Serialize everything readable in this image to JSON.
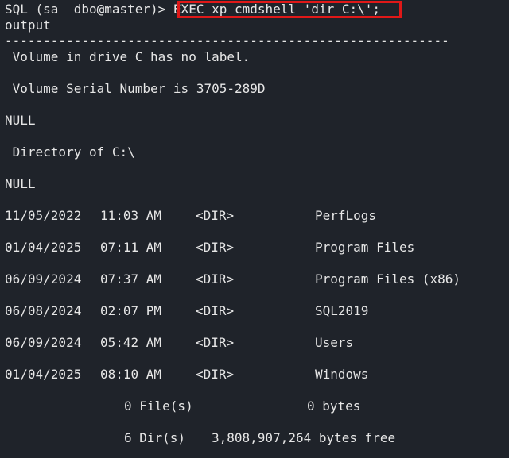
{
  "prompt": {
    "prefix": "SQL (sa  dbo@master)> ",
    "command": "EXEC xp_cmdshell 'dir C:\\';"
  },
  "output": {
    "header": "output",
    "separator": "----------------------------------------------------------",
    "volume_label": " Volume in drive C has no label.",
    "serial": " Volume Serial Number is 3705-289D",
    "null_1": "NULL",
    "directory": " Directory of C:\\",
    "null_2": "NULL",
    "entries": [
      {
        "date": "11/05/2022",
        "time": "11:03 AM",
        "type": "<DIR>",
        "name": "PerfLogs"
      },
      {
        "date": "01/04/2025",
        "time": "07:11 AM",
        "type": "<DIR>",
        "name": "Program Files"
      },
      {
        "date": "06/09/2024",
        "time": "07:37 AM",
        "type": "<DIR>",
        "name": "Program Files (x86)"
      },
      {
        "date": "06/08/2024",
        "time": "02:07 PM",
        "type": "<DIR>",
        "name": "SQL2019"
      },
      {
        "date": "06/09/2024",
        "time": "05:42 AM",
        "type": "<DIR>",
        "name": "Users"
      },
      {
        "date": "01/04/2025",
        "time": "08:10 AM",
        "type": "<DIR>",
        "name": "Windows"
      }
    ],
    "files_summary": {
      "count": "0 File(s)",
      "size": "0 bytes"
    },
    "dirs_summary": {
      "count": "6 Dir(s)",
      "free": "3,808,907,264 bytes free"
    }
  },
  "colors": {
    "background": "#1f232a",
    "text": "#e6e6e6",
    "highlight_border": "#e01818"
  }
}
